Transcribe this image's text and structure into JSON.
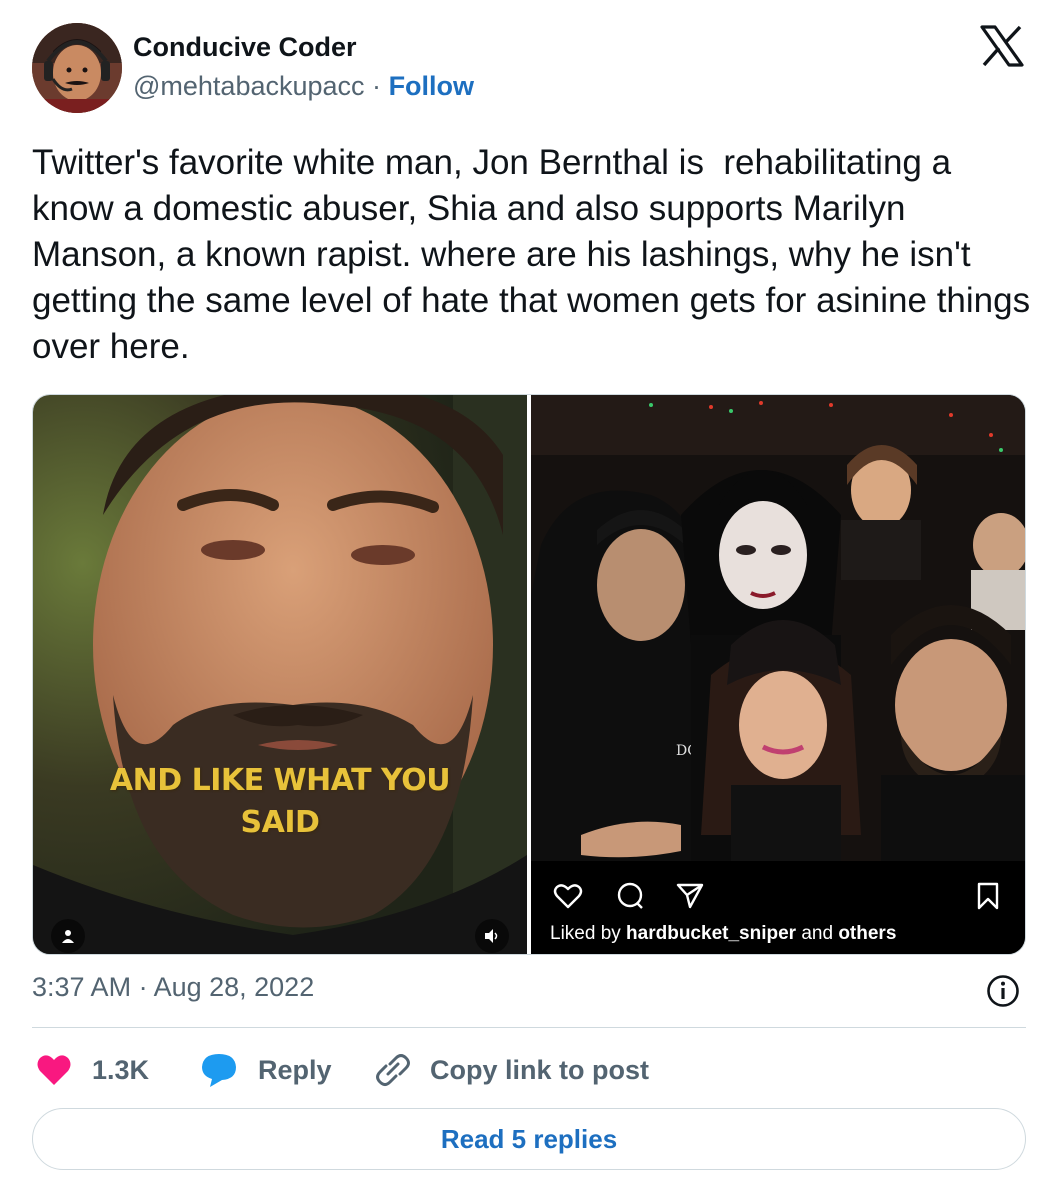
{
  "author": {
    "name": "Conducive Coder",
    "handle": "@mehtabackupacc",
    "separator": "·",
    "follow_label": "Follow"
  },
  "tweet": {
    "text": "Twitter's favorite white man, Jon Bernthal is  rehabilitating a know a domestic abuser, Shia and also supports Marilyn Manson, a known rapist. where are his lashings, why he isn't getting the same level of hate that women gets for asinine things over here.",
    "timestamp": "3:37 AM · Aug 28, 2022"
  },
  "media": {
    "left_caption_line1": "AND LIKE WHAT YOU",
    "left_caption_line2": "SAID",
    "right_liked_prefix": "Liked by ",
    "right_liked_user": "hardbucket_sniper",
    "right_liked_mid": " and ",
    "right_liked_suffix": "others",
    "hoodie_text": "DOG"
  },
  "actions": {
    "like_count": "1.3K",
    "reply_label": "Reply",
    "copy_label": "Copy link to post"
  },
  "read_replies_label": "Read 5 replies",
  "colors": {
    "accent": "#1d6fc0",
    "like": "#f91880",
    "reply": "#1d9bf0",
    "muted": "#536471",
    "caption": "#e8c23a"
  },
  "icons": [
    "x-logo-icon",
    "info-icon",
    "heart-icon",
    "reply-bubble-icon",
    "link-icon",
    "person-icon",
    "volume-icon",
    "ig-heart-icon",
    "ig-comment-icon",
    "ig-share-icon",
    "ig-bookmark-icon"
  ]
}
